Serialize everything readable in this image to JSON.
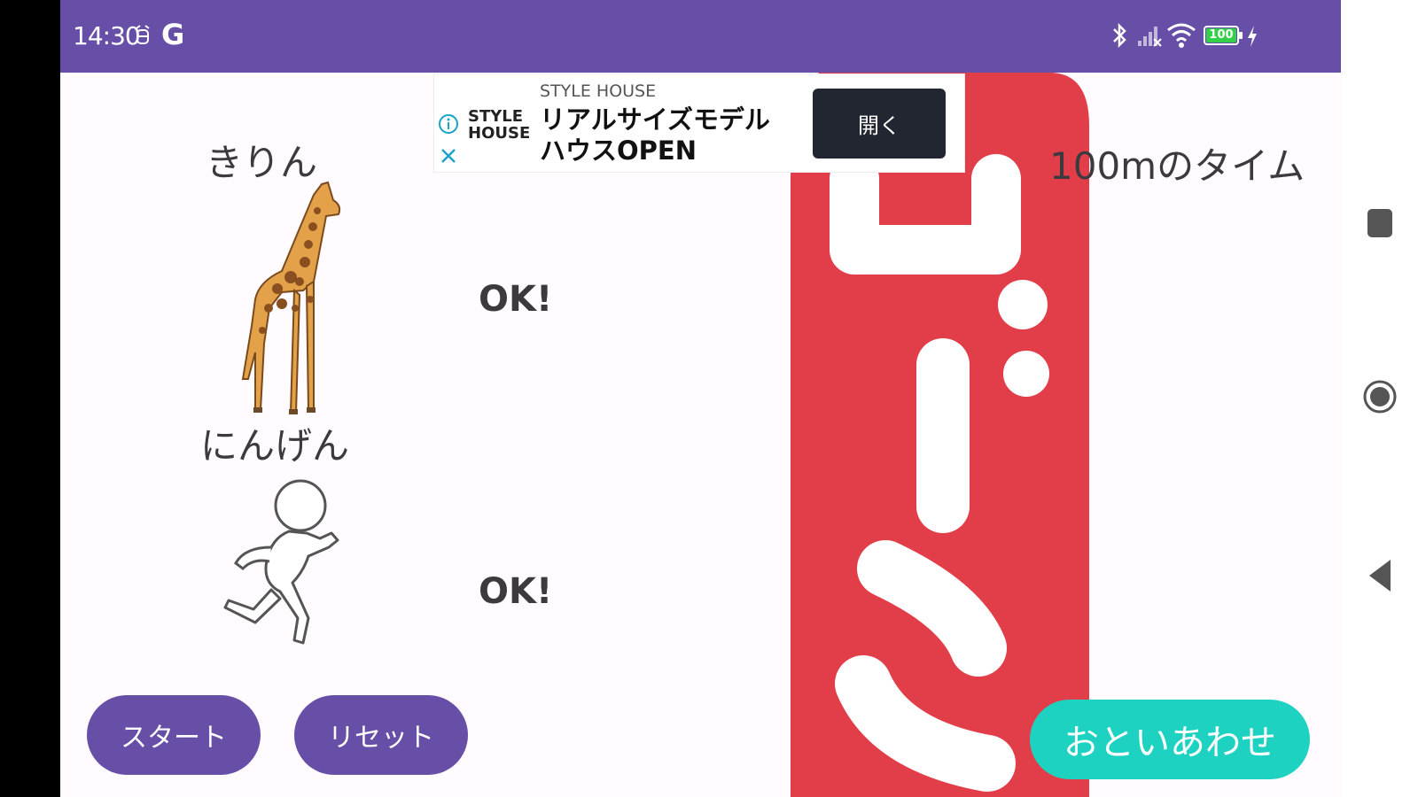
{
  "status_bar": {
    "time": "14:30",
    "g_label": "G",
    "battery": "100"
  },
  "main": {
    "giraffe_label": "きりん",
    "human_label": "にんげん",
    "ok_top": "OK!",
    "ok_bottom": "OK!",
    "time_label": "100mのタイム"
  },
  "buttons": {
    "start": "スタート",
    "reset": "リセット",
    "contact": "おといあわせ"
  },
  "ad": {
    "brand_line1": "STYLE",
    "brand_line2": "HOUSE",
    "advertiser": "STYLE HOUSE",
    "headline_line1": "リアルサイズモデル",
    "headline_line2": "ハウスOPEN",
    "open_button": "開く"
  },
  "colors": {
    "status_bar": "#674ea7",
    "primary_button": "#674ea7",
    "contact_button": "#1ed2c2",
    "goal_banner": "#e23e4a"
  },
  "icons": {
    "alarm": "alarm-icon",
    "bluetooth": "bluetooth-icon",
    "signal": "signal-icon",
    "wifi": "wifi-icon",
    "battery": "battery-icon",
    "charging": "charging-icon",
    "ad_info": "info-icon",
    "ad_close": "close-icon",
    "nav_square": "recents-icon",
    "nav_circle": "home-icon",
    "nav_triangle": "back-icon"
  }
}
